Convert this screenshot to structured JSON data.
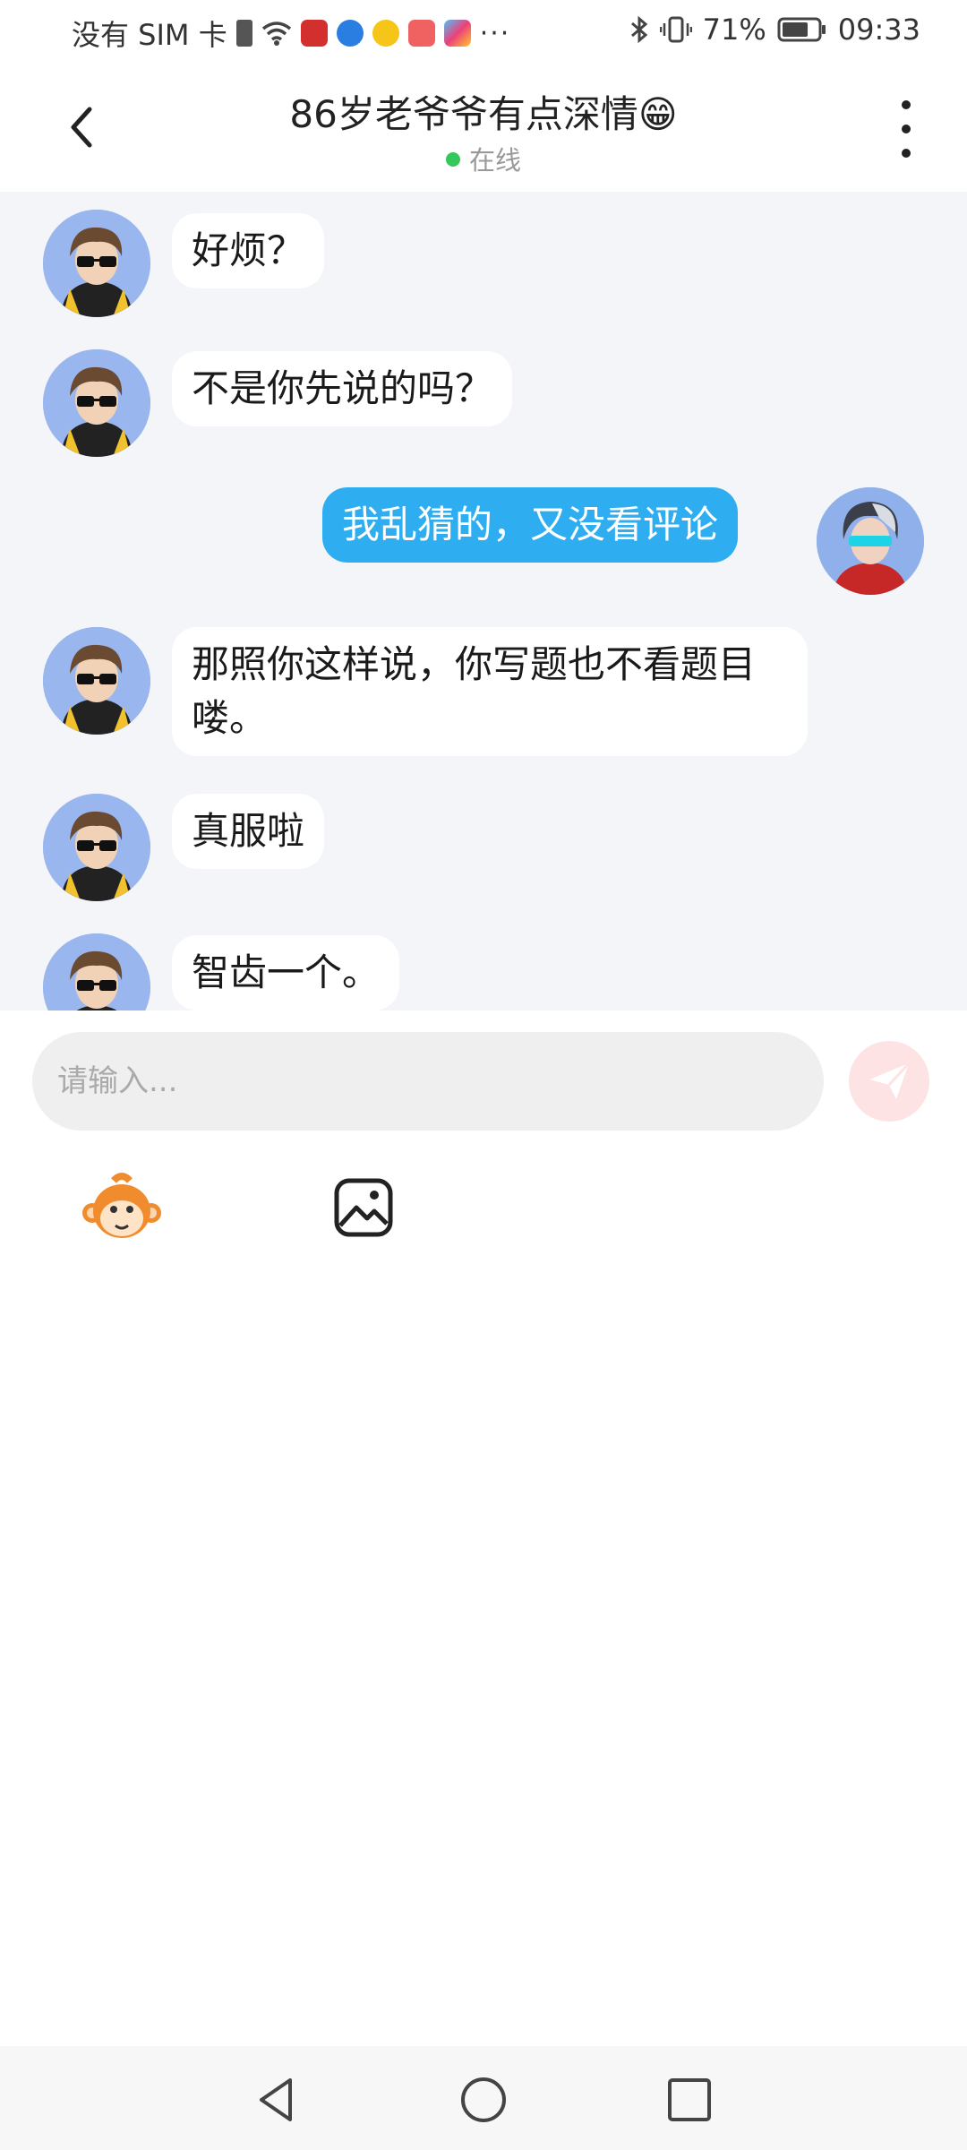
{
  "status_bar": {
    "carrier": "没有 SIM 卡",
    "more_indicator": "···",
    "battery": "71%",
    "time": "09:33"
  },
  "header": {
    "title": "86岁老爷爷有点深情😁",
    "presence": "在线",
    "presence_color": "#34c759"
  },
  "messages": [
    {
      "sender": "other",
      "text": "好烦？"
    },
    {
      "sender": "other",
      "text": "不是你先说的吗？"
    },
    {
      "sender": "me",
      "text": "我乱猜的，又没看评论"
    },
    {
      "sender": "other",
      "text": "那照你这样说，你写题也不看题目喽。"
    },
    {
      "sender": "other",
      "text": "真服啦"
    },
    {
      "sender": "other",
      "text": "智齿一个。"
    }
  ],
  "composer": {
    "placeholder": "请输入..."
  },
  "icons": {
    "back": "chevron-left-icon",
    "more": "more-vertical-icon",
    "send": "paper-plane-icon",
    "emoji": "monkey-sticker-icon",
    "image": "image-icon"
  },
  "colors": {
    "my_bubble": "#2eaef0",
    "chat_bg": "#f3f5f8",
    "send_bg": "#fde3e3"
  }
}
